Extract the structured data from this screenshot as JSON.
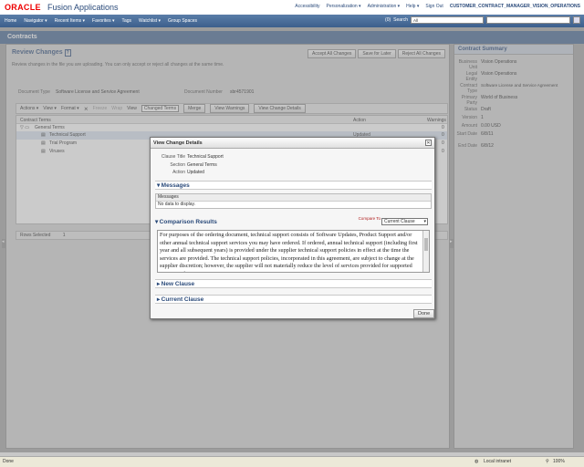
{
  "brand": {
    "logo": "ORACLE",
    "app": "Fusion Applications"
  },
  "toplinks": [
    "Accessibility",
    "Personalization ▾",
    "Administration ▾",
    "Help ▾",
    "Sign Out",
    "CUSTOMER_CONTRACT_MANAGER_VISION_OPERATIONS"
  ],
  "nav": {
    "items": [
      "Home",
      "Navigator ▾",
      "Recent Items ▾",
      "Favorites ▾",
      "Tags",
      "Watchlist ▾",
      "Group Spaces"
    ],
    "search_label": "Search",
    "search_scope": "All",
    "count": "(0)"
  },
  "page_title": "Contracts",
  "review": {
    "title": "Review Changes",
    "help": "?",
    "desc": "Review changes in the file you are uploading. You can only accept or reject all changes at the same time.",
    "buttons": [
      "Accept All Changes",
      "Save for Later",
      "Reject All Changes"
    ],
    "doc_type_label": "Document Type",
    "doc_type": "Software License and Service Agreement",
    "doc_num_label": "Document Number",
    "doc_num": "sbr4571901",
    "toolbar": {
      "actions": "Actions ▾",
      "view": "View ▾",
      "format": "Format ▾",
      "freeze": "Freeze",
      "wrap": "Wrap",
      "view_label": "View",
      "view_value": "Changed Terms",
      "merge": "Merge",
      "view_warnings": "View Warnings",
      "view_change_details": "View Change Details"
    },
    "table": {
      "headers": [
        "Contract Terms",
        "Action",
        "Warnings"
      ],
      "rows": [
        {
          "label": "General Terms",
          "action": "",
          "warn": "0"
        },
        {
          "label": "Technical Support",
          "action": "Updated",
          "warn": "0"
        },
        {
          "label": "Trial Program",
          "action": "",
          "warn": "0"
        },
        {
          "label": "Viruses",
          "action": "",
          "warn": "0"
        }
      ]
    },
    "rows_selected_label": "Rows Selected",
    "rows_selected": "1"
  },
  "summary": {
    "title": "Contract Summary",
    "fields": [
      {
        "label": "Business Unit",
        "value": "Vision Operations"
      },
      {
        "label": "Legal Entity",
        "value": "Vision Operations"
      },
      {
        "label": "Contract Type",
        "value": "Software License and Service Agreement"
      },
      {
        "label": "Primary Party",
        "value": "World of Business"
      },
      {
        "label": "Status",
        "value": "Draft"
      },
      {
        "label": "Version",
        "value": "1"
      },
      {
        "label": "Amount",
        "value": "0.00  USD"
      },
      {
        "label": "Start Date",
        "value": "6/8/11"
      },
      {
        "label": "End Date",
        "value": "6/8/12"
      }
    ]
  },
  "dialog": {
    "title": "View Change Details",
    "close": "✕",
    "clause_title_label": "Clause Title",
    "clause_title": "Technical Support",
    "section_label": "Section",
    "section": "General Terms",
    "action_label": "Action",
    "action": "Updated",
    "messages_title": "Messages",
    "messages_col": "Messages",
    "messages_empty": "No data to display.",
    "compare_title": "Comparison Results",
    "compare_to_label": "Compare To",
    "compare_to_value": "Current Clause",
    "compare_text": "For purposes of the ordering document, technical support consists of Software Updates, Product Support and/or other annual technical support services you may have ordered. If ordered, annual technical support (including first year and all subsequent years) is provided under the supplier technical support policies in effect at the time the services are provided. The technical support policies, incorporated in this agreement, are subject to change at the supplier discretion; however, the supplier will not materially reduce the level of services provided for supported programs during",
    "new_clause": "New Clause",
    "current_clause": "Current Clause",
    "done": "Done"
  },
  "status": {
    "left": "Done",
    "zone": "Local intranet",
    "zoom": "100%"
  }
}
